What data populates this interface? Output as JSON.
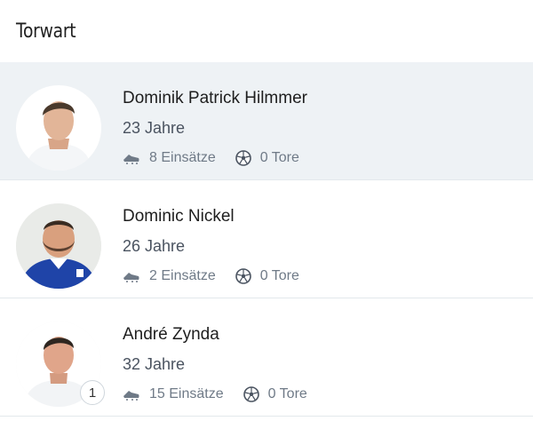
{
  "section": {
    "title": "Torwart"
  },
  "players": [
    {
      "name": "Dominik Patrick Hilmmer",
      "age": "23 Jahre",
      "appearances": "8 Einsätze",
      "goals": "0 Tore",
      "badge": ""
    },
    {
      "name": "Dominic Nickel",
      "age": "26 Jahre",
      "appearances": "2 Einsätze",
      "goals": "0 Tore",
      "badge": ""
    },
    {
      "name": "André Zynda",
      "age": "32 Jahre",
      "appearances": "15 Einsätze",
      "goals": "0 Tore",
      "badge": "1"
    }
  ],
  "icons": {
    "appearances": "football-boot-icon",
    "goals": "soccer-ball-icon"
  },
  "colors": {
    "highlight_row": "#eef2f5",
    "stat_text": "#6f7a87",
    "divider": "#e3e8ec"
  }
}
